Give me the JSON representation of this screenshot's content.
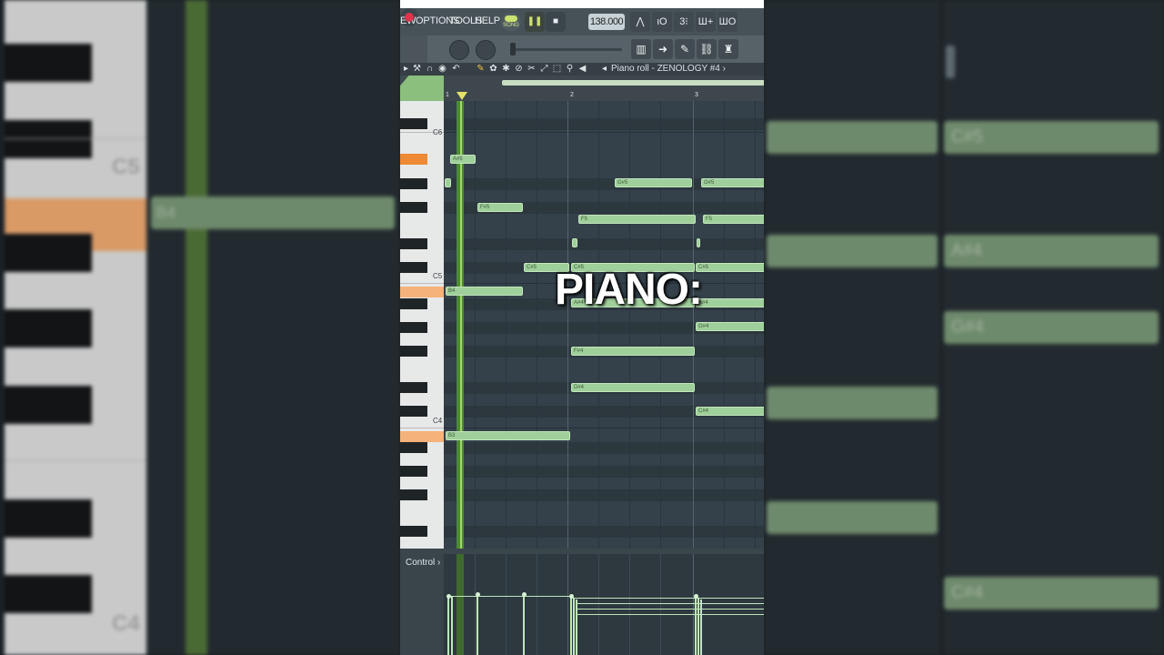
{
  "menu": {
    "view": "EW",
    "options": "OPTIONS",
    "tools": "TOOLS",
    "help": "HELP"
  },
  "transport": {
    "mode_label": "SONG",
    "tempo": "138.000"
  },
  "piano_roll": {
    "title": "Piano roll - ZENOLOGY #4",
    "arrow": "›"
  },
  "ruler": {
    "bars": [
      "1",
      "2",
      "3"
    ]
  },
  "keyboard": {
    "labels": [
      "C6",
      "C5",
      "C4"
    ]
  },
  "notes": [
    {
      "label": "A#5"
    },
    {
      "label": ""
    },
    {
      "label": "G#5"
    },
    {
      "label": "G#5"
    },
    {
      "label": "F#5"
    },
    {
      "label": "F5"
    },
    {
      "label": "F5"
    },
    {
      "label": ""
    },
    {
      "label": ""
    },
    {
      "label": "C#5"
    },
    {
      "label": "C#5"
    },
    {
      "label": "C#5"
    },
    {
      "label": "B4"
    },
    {
      "label": "A#4"
    },
    {
      "label": "A#4"
    },
    {
      "label": "G#4"
    },
    {
      "label": "F#4"
    },
    {
      "label": "D#4"
    },
    {
      "label": "C#4"
    },
    {
      "label": "B3"
    }
  ],
  "overlay": {
    "caption": "PIANO:"
  },
  "control": {
    "label": "Control",
    "arrow": "›"
  },
  "background": {
    "left_keys": [
      "C5",
      "C4"
    ],
    "left_note": "B4",
    "right_notes": [
      "C#5",
      "A#4",
      "G#4",
      "C#4"
    ]
  },
  "colors": {
    "note": "#9fcf9a",
    "grid": "#34414a",
    "playhead": "#e5e26a",
    "orange_key": "#ee8a33",
    "record": "#e0344a"
  }
}
